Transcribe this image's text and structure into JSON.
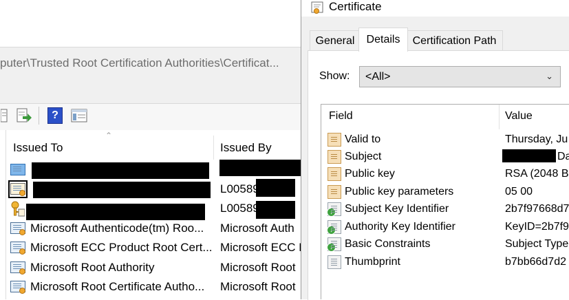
{
  "background_window": {
    "path": "puter\\Trusted Root Certification Authorities\\Certificat...",
    "toolbar": [
      {
        "icon": "properties-icon"
      },
      {
        "icon": "export-list-icon"
      },
      {
        "icon": "help-icon",
        "glyph": "?"
      },
      {
        "icon": "mmc-view-icon"
      }
    ],
    "columns": {
      "issued_to": "Issued To",
      "issued_by": "Issued By"
    },
    "rows": [
      {
        "issued_to": "",
        "issued_by": "",
        "icon": "certificate-icon"
      },
      {
        "issued_to": "",
        "issued_by": "L00589",
        "icon": "certificate-icon"
      },
      {
        "issued_to": "",
        "issued_by": "L00589",
        "icon": "certificate-key-icon"
      },
      {
        "issued_to": "Microsoft Authenticode(tm) Roo...",
        "issued_by": "Microsoft Auth",
        "icon": "certificate-icon"
      },
      {
        "issued_to": "Microsoft ECC Product Root Cert...",
        "issued_by": "Microsoft ECC P",
        "icon": "certificate-icon"
      },
      {
        "issued_to": "Microsoft Root Authority",
        "issued_by": "Microsoft Root",
        "icon": "certificate-icon"
      },
      {
        "issued_to": "Microsoft Root Certificate Autho...",
        "issued_by": "Microsoft Root",
        "icon": "certificate-icon"
      }
    ]
  },
  "dialog": {
    "title": "Certificate",
    "tabs": [
      {
        "label": "General",
        "active": false
      },
      {
        "label": "Details",
        "active": true
      },
      {
        "label": "Certification Path",
        "active": false
      }
    ],
    "show_label": "Show:",
    "show_value": "<All>",
    "columns": {
      "field": "Field",
      "value": "Value"
    },
    "fields": [
      {
        "name": "Valid to",
        "value": "Thursday, Ju",
        "icon": "field-doc-icon"
      },
      {
        "name": "Subject",
        "value": "Da",
        "icon": "field-doc-icon"
      },
      {
        "name": "Public key",
        "value": "RSA (2048 Bi",
        "icon": "field-doc-icon"
      },
      {
        "name": "Public key parameters",
        "value": "05 00",
        "icon": "field-doc-icon"
      },
      {
        "name": "Subject Key Identifier",
        "value": "2b7f97668d7",
        "icon": "extension-icon"
      },
      {
        "name": "Authority Key Identifier",
        "value": "KeyID=2b7f9",
        "icon": "extension-icon"
      },
      {
        "name": "Basic Constraints",
        "value": "Subject Type",
        "icon": "extension-icon"
      },
      {
        "name": "Thumbprint",
        "value": "b7bb66d7d2",
        "icon": "property-icon"
      }
    ]
  },
  "colors": {
    "panel": "#f0f0f0",
    "selection_bg": "#e5e5e5",
    "help_icon": "#2b50c8"
  }
}
